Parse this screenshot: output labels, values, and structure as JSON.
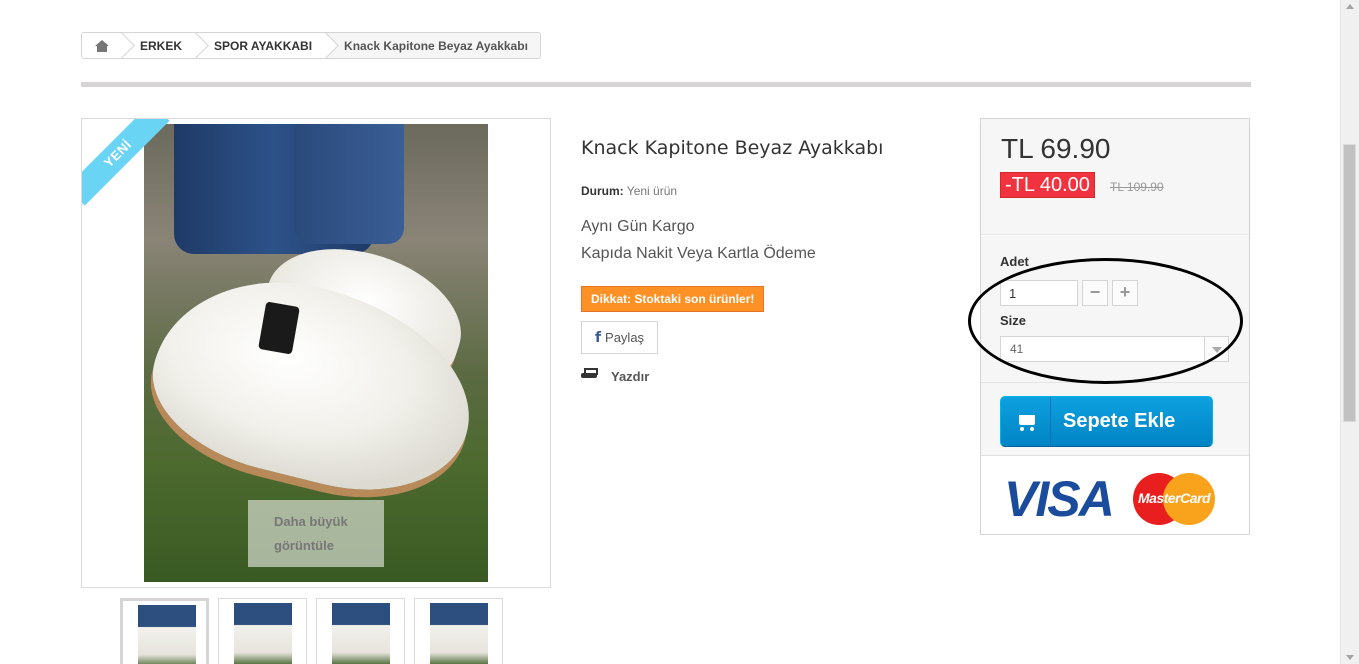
{
  "breadcrumb": {
    "home_icon": "home-icon",
    "items": [
      "ERKEK",
      "SPOR AYAKKABI"
    ],
    "current": "Knack Kapitone Beyaz Ayakkabı"
  },
  "product": {
    "badge": "YENİ",
    "zoom": {
      "line1": "Daha büyük",
      "line2": "görüntüle"
    },
    "thumbnail_count": 4,
    "title": "Knack Kapitone Beyaz Ayakkabı",
    "condition_label": "Durum:",
    "condition_value": "Yeni ürün",
    "description_lines": [
      "Aynı Gün Kargo",
      "Kapıda Nakit Veya Kartla Ödeme"
    ],
    "warning": "Dikkat: Stoktaki son ürünler!",
    "share_label": "Paylaş",
    "share_icon": "facebook-icon",
    "print_label": "Yazdır",
    "print_icon": "printer-icon"
  },
  "buy_box": {
    "price": "TL 69.90",
    "discount": "-TL 40.00",
    "old_price": "TL 109.90",
    "quantity_label": "Adet",
    "quantity_value": "1",
    "minus": "−",
    "plus": "+",
    "size_label": "Size",
    "size_value": "41",
    "add_to_cart": "Sepete Ekle",
    "cart_icon": "cart-icon",
    "payment_logos": {
      "visa": "VISA",
      "mastercard": "MasterCard"
    }
  },
  "colors": {
    "accent_blue": "#0097d8",
    "discount_red": "#f13340",
    "warning_orange": "#fe9126",
    "ribbon_blue": "#6ad4f5"
  }
}
